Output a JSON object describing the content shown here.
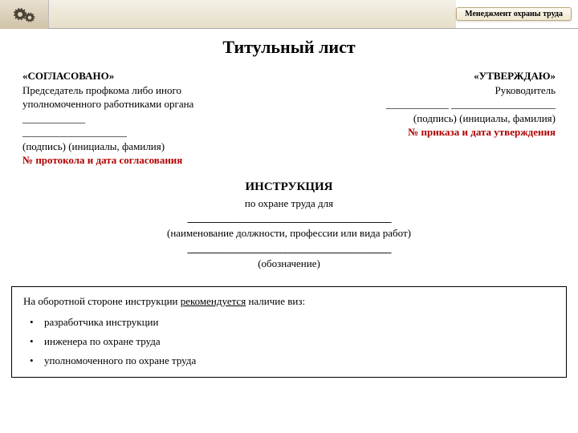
{
  "header": {
    "badge": "Менеджмент охраны труда"
  },
  "title": "Титульный лист",
  "left": {
    "heading": "«СОГЛАСОВАНО»",
    "line1": "Председатель профкома либо иного",
    "line2": "уполномоченного работниками органа",
    "blank1": "____________",
    "blank2": "____________________",
    "sign": "(подпись)   (инициалы, фамилия)",
    "red": " № протокола и дата согласования"
  },
  "right": {
    "heading": " «УТВЕРЖДАЮ»",
    "line1": "Руководитель",
    "blank": "____________ ____________________",
    "sign": "(подпись)   (инициалы, фамилия)",
    "red": "№ приказа и дата утверждения"
  },
  "center": {
    "instr": "ИНСТРУКЦИЯ",
    "for": "по охране труда для",
    "rule": "______________________________________________",
    "hint1": "(наименование должности, профессии или вида работ)",
    "hint2": "(обозначение)"
  },
  "footer": {
    "intro_a": "На оборотной стороне инструкции ",
    "intro_u": "рекомендуется",
    "intro_b": " наличие виз:",
    "items": [
      "разработчика инструкции",
      "инженера по охране труда",
      "уполномоченного по охране труда"
    ]
  }
}
